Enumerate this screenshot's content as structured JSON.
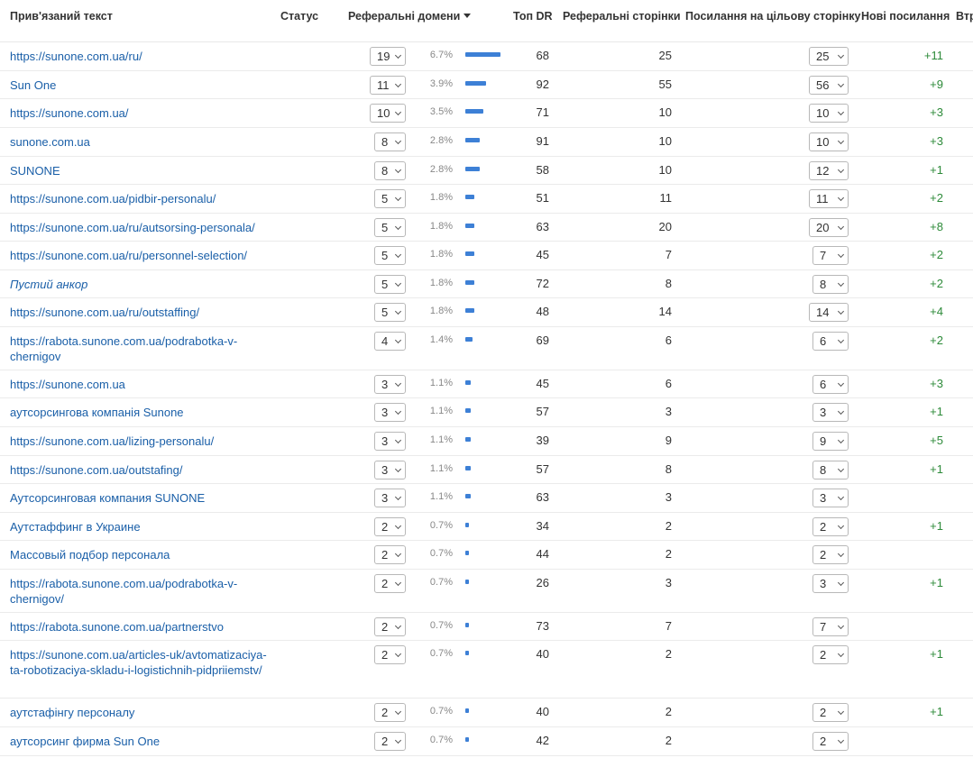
{
  "header": {
    "anchor": "Прив'язаний текст",
    "status": "Статус",
    "ref_domains": "Реферальні домени",
    "top_dr": "Топ DR",
    "ref_pages": "Реферальні сторінки",
    "links_to_target": "Посилання на цільову сторінку",
    "new_links": "Нові посилання",
    "lost": "Втр"
  },
  "colors": {
    "link": "#1a5fa8",
    "bar": "#3d80d6",
    "positive": "#2e8b3a"
  },
  "rows": [
    {
      "anchor": "https://sunone.com.ua/ru/",
      "domains": "19",
      "pct": "6.7%",
      "share": 6.7,
      "dr": "68",
      "pages": "25",
      "links": "25",
      "new": "+11"
    },
    {
      "anchor": "Sun One",
      "domains": "11",
      "pct": "3.9%",
      "share": 3.9,
      "dr": "92",
      "pages": "55",
      "links": "56",
      "new": "+9"
    },
    {
      "anchor": "https://sunone.com.ua/",
      "domains": "10",
      "pct": "3.5%",
      "share": 3.5,
      "dr": "71",
      "pages": "10",
      "links": "10",
      "new": "+3"
    },
    {
      "anchor": "sunone.com.ua",
      "domains": "8",
      "pct": "2.8%",
      "share": 2.8,
      "dr": "91",
      "pages": "10",
      "links": "10",
      "new": "+3"
    },
    {
      "anchor": "SUNONE",
      "domains": "8",
      "pct": "2.8%",
      "share": 2.8,
      "dr": "58",
      "pages": "10",
      "links": "12",
      "new": "+1"
    },
    {
      "anchor": "https://sunone.com.ua/pidbir-personalu/",
      "domains": "5",
      "pct": "1.8%",
      "share": 1.8,
      "dr": "51",
      "pages": "11",
      "links": "11",
      "new": "+2"
    },
    {
      "anchor": "https://sunone.com.ua/ru/autsorsing-personala/",
      "domains": "5",
      "pct": "1.8%",
      "share": 1.8,
      "dr": "63",
      "pages": "20",
      "links": "20",
      "new": "+8"
    },
    {
      "anchor": "https://sunone.com.ua/ru/personnel-selection/",
      "domains": "5",
      "pct": "1.8%",
      "share": 1.8,
      "dr": "45",
      "pages": "7",
      "links": "7",
      "new": "+2"
    },
    {
      "anchor": "Пустий анкор",
      "italic": true,
      "domains": "5",
      "pct": "1.8%",
      "share": 1.8,
      "dr": "72",
      "pages": "8",
      "links": "8",
      "new": "+2"
    },
    {
      "anchor": "https://sunone.com.ua/ru/outstaffing/",
      "domains": "5",
      "pct": "1.8%",
      "share": 1.8,
      "dr": "48",
      "pages": "14",
      "links": "14",
      "new": "+4"
    },
    {
      "anchor": "https://rabota.sunone.com.ua/podrabotka-v-chernigov",
      "domains": "4",
      "pct": "1.4%",
      "share": 1.4,
      "dr": "69",
      "pages": "6",
      "links": "6",
      "new": "+2"
    },
    {
      "anchor": "https://sunone.com.ua",
      "domains": "3",
      "pct": "1.1%",
      "share": 1.1,
      "dr": "45",
      "pages": "6",
      "links": "6",
      "new": "+3"
    },
    {
      "anchor": "аутсорсингова компанія Sunone",
      "domains": "3",
      "pct": "1.1%",
      "share": 1.1,
      "dr": "57",
      "pages": "3",
      "links": "3",
      "new": "+1"
    },
    {
      "anchor": "https://sunone.com.ua/lizing-personalu/",
      "domains": "3",
      "pct": "1.1%",
      "share": 1.1,
      "dr": "39",
      "pages": "9",
      "links": "9",
      "new": "+5"
    },
    {
      "anchor": "https://sunone.com.ua/outstafing/",
      "domains": "3",
      "pct": "1.1%",
      "share": 1.1,
      "dr": "57",
      "pages": "8",
      "links": "8",
      "new": "+1"
    },
    {
      "anchor": "Аутсорсинговая компания SUNONE",
      "domains": "3",
      "pct": "1.1%",
      "share": 1.1,
      "dr": "63",
      "pages": "3",
      "links": "3",
      "new": ""
    },
    {
      "anchor": "Аутстаффинг в Украине",
      "domains": "2",
      "pct": "0.7%",
      "share": 0.7,
      "dr": "34",
      "pages": "2",
      "links": "2",
      "new": "+1"
    },
    {
      "anchor": "Массовый подбор персонала",
      "domains": "2",
      "pct": "0.7%",
      "share": 0.7,
      "dr": "44",
      "pages": "2",
      "links": "2",
      "new": ""
    },
    {
      "anchor": "https://rabota.sunone.com.ua/podrabotka-v-chernigov/",
      "domains": "2",
      "pct": "0.7%",
      "share": 0.7,
      "dr": "26",
      "pages": "3",
      "links": "3",
      "new": "+1"
    },
    {
      "anchor": "https://rabota.sunone.com.ua/partnerstvo",
      "domains": "2",
      "pct": "0.7%",
      "share": 0.7,
      "dr": "73",
      "pages": "7",
      "links": "7",
      "new": ""
    },
    {
      "anchor": "https://sunone.com.ua/articles-uk/avtomatizaciya-ta-robotizaciya-skladu-i-logistichnih-pidpriiemstv/",
      "domains": "2",
      "pct": "0.7%",
      "share": 0.7,
      "dr": "40",
      "pages": "2",
      "links": "2",
      "new": "+1"
    },
    {
      "anchor": "аутстафінгу персоналу",
      "domains": "2",
      "pct": "0.7%",
      "share": 0.7,
      "dr": "40",
      "pages": "2",
      "links": "2",
      "new": "+1"
    },
    {
      "anchor": "аутсорсинг фирма Sun One",
      "domains": "2",
      "pct": "0.7%",
      "share": 0.7,
      "dr": "42",
      "pages": "2",
      "links": "2",
      "new": ""
    }
  ]
}
